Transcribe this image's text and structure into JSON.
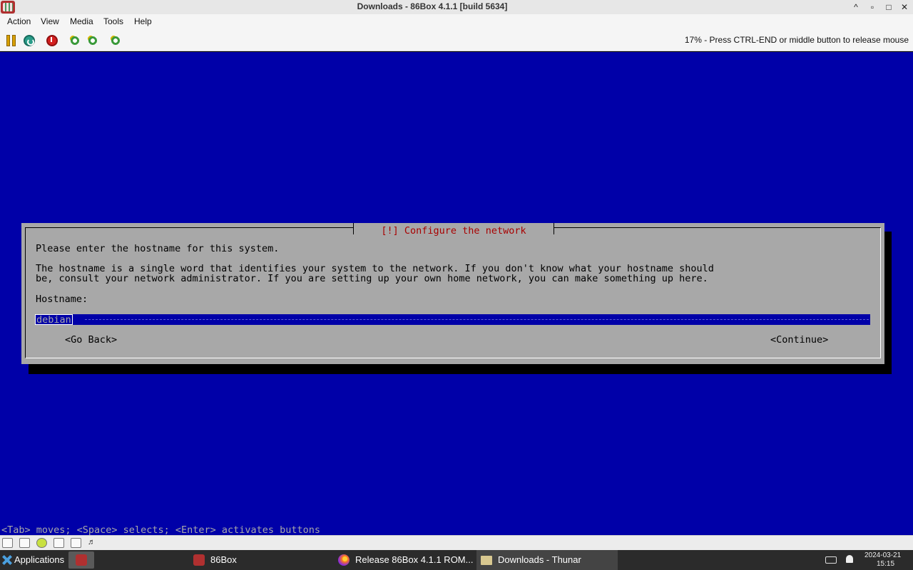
{
  "window": {
    "title": "Downloads - 86Box 4.1.1 [build 5634]",
    "minimize_icon": "^",
    "maximize_icon": "□",
    "close_icon": "✕"
  },
  "menubar": {
    "items": [
      "Action",
      "View",
      "Media",
      "Tools",
      "Help"
    ]
  },
  "toolbar": {
    "buttons": [
      "pause-icon",
      "reset-icon",
      "power-icon",
      "ctrl-alt-del-icon",
      "ctrl-alt-esc-icon",
      "settings-icon"
    ],
    "status": "17% - Press CTRL-END or middle button to release mouse"
  },
  "installer": {
    "dialog_title": "[!] Configure the network",
    "prompt": "Please enter the hostname for this system.",
    "description_line1": "The hostname is a single word that identifies your system to the network. If you don't know what your hostname should",
    "description_line2": "be, consult your network administrator. If you are setting up your own home network, you can make something up here.",
    "field_label": "Hostname:",
    "hostname_value": "debian",
    "go_back": "<Go Back>",
    "continue": "<Continue>",
    "help_line": "<Tab> moves; <Space> selects; <Enter> activates buttons",
    "colors": {
      "background": "#0000a8",
      "dialog": "#a8a8a8",
      "title": "#a80000"
    }
  },
  "taskbar": {
    "applications": "Applications",
    "tasks": [
      "86Box",
      "Release 86Box 4.1.1 ROM...",
      "Downloads - Thunar"
    ],
    "clock_date": "2024-03-21",
    "clock_time": "15:15"
  }
}
